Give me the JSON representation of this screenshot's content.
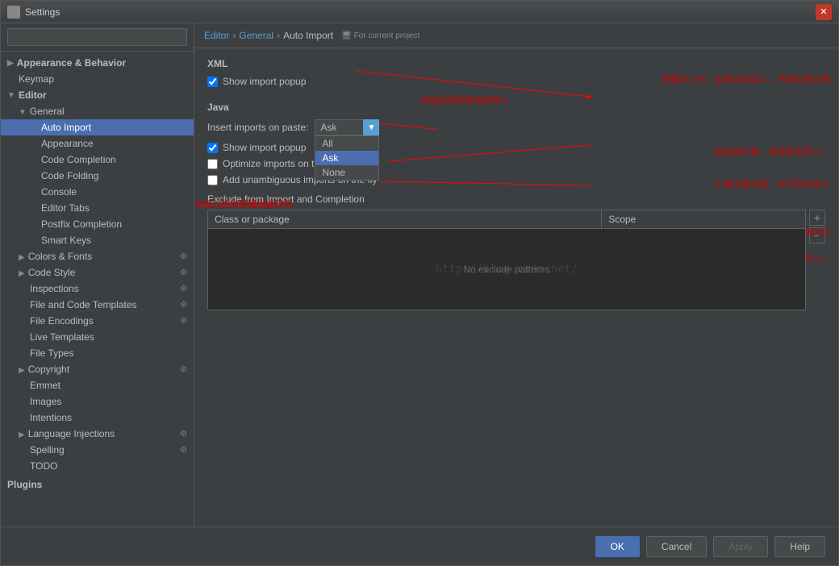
{
  "window": {
    "title": "Settings",
    "close_label": "✕"
  },
  "search": {
    "placeholder": ""
  },
  "breadcrumb": {
    "parts": [
      "Editor",
      "General",
      "Auto Import"
    ],
    "project_label": "For current project"
  },
  "sidebar": {
    "appearance_behavior": "Appearance & Behavior",
    "keymap": "Keymap",
    "editor": "Editor",
    "general": "General",
    "items": [
      {
        "id": "auto-import",
        "label": "Auto Import",
        "selected": true,
        "indent": 3
      },
      {
        "id": "appearance",
        "label": "Appearance",
        "indent": 3
      },
      {
        "id": "code-completion",
        "label": "Code Completion",
        "indent": 3
      },
      {
        "id": "code-folding",
        "label": "Code Folding",
        "indent": 3
      },
      {
        "id": "console",
        "label": "Console",
        "indent": 3
      },
      {
        "id": "editor-tabs",
        "label": "Editor Tabs",
        "indent": 3
      },
      {
        "id": "postfix-completion",
        "label": "Postfix Completion",
        "indent": 3
      },
      {
        "id": "smart-keys",
        "label": "Smart Keys",
        "indent": 3
      },
      {
        "id": "colors-fonts",
        "label": "Colors & Fonts",
        "indent": 2,
        "arrow": "▶",
        "has_icon": true
      },
      {
        "id": "code-style",
        "label": "Code Style",
        "indent": 2,
        "arrow": "▶",
        "has_icon": true
      },
      {
        "id": "inspections",
        "label": "Inspections",
        "indent": 2,
        "has_icon": true
      },
      {
        "id": "file-code-templates",
        "label": "File and Code Templates",
        "indent": 2,
        "has_icon": true
      },
      {
        "id": "file-encodings",
        "label": "File Encodings",
        "indent": 2,
        "has_icon": true
      },
      {
        "id": "live-templates",
        "label": "Live Templates",
        "indent": 2
      },
      {
        "id": "file-types",
        "label": "File Types",
        "indent": 2
      },
      {
        "id": "copyright",
        "label": "Copyright",
        "indent": 2,
        "arrow": "▶",
        "has_icon": true
      },
      {
        "id": "emmet",
        "label": "Emmet",
        "indent": 2
      },
      {
        "id": "images",
        "label": "Images",
        "indent": 2
      },
      {
        "id": "intentions",
        "label": "Intentions",
        "indent": 2
      },
      {
        "id": "language-injections",
        "label": "Language Injections",
        "indent": 2,
        "arrow": "▶",
        "has_icon": true
      },
      {
        "id": "spelling",
        "label": "Spelling",
        "indent": 2,
        "has_icon": true
      },
      {
        "id": "todo",
        "label": "TODO",
        "indent": 2
      }
    ],
    "plugins": "Plugins"
  },
  "content": {
    "xml_label": "XML",
    "show_import_popup_xml": true,
    "show_import_popup_xml_label": "Show import popup",
    "java_label": "Java",
    "insert_imports_label": "Insert imports on paste:",
    "insert_imports_value": "Ask",
    "insert_imports_options": [
      "All",
      "Ask",
      "None"
    ],
    "show_import_popup_java": true,
    "show_import_popup_java_label": "Show import popup",
    "optimize_imports_label": "Optimize imports on the fly",
    "optimize_imports_checked": false,
    "add_unambiguous_label": "Add unambiguous imports on the fly",
    "add_unambiguous_checked": false,
    "exclude_label": "Exclude from Import and Completion",
    "table": {
      "col1": "Class or package",
      "col2": "Scope",
      "empty_text": "No exclude patterns"
    },
    "btn_add": "+",
    "btn_remove": "−"
  },
  "annotations": [
    {
      "id": "ann1",
      "text": "需要导入时，全部自动导入，不弹出提示框"
    },
    {
      "id": "ann2",
      "text": "在粘贴的时候添加导入"
    },
    {
      "id": "ann3",
      "text": "弹出提示框，选择是否导入。"
    },
    {
      "id": "ann4",
      "text": "不弹出提示框，也不自动导入"
    },
    {
      "id": "ann5",
      "text": "优化导入，会去掉没有用到的包"
    },
    {
      "id": "ann6",
      "text": "添加清楚的导入，就是不带*的导入。"
    },
    {
      "id": "ann7",
      "text": "在导入的时候弹出选择框"
    }
  ],
  "buttons": {
    "ok": "OK",
    "cancel": "Cancel",
    "apply": "Apply",
    "help": "Help"
  },
  "watermark": "http://blog.csdn.net/"
}
